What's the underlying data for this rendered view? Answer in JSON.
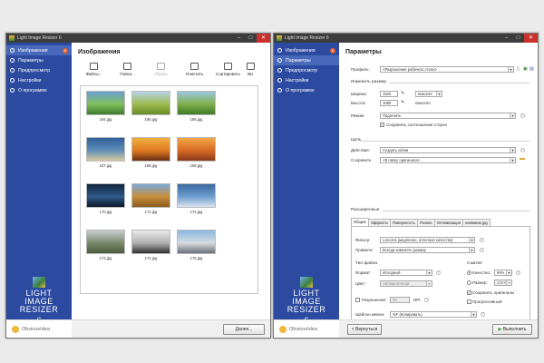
{
  "window_title": "Light Image Resizer 6",
  "nav": {
    "items": [
      "Изображения",
      "Параметры",
      "Предпросмотр",
      "Настройки",
      "О программе"
    ],
    "badge": "6"
  },
  "logo": {
    "line1": "LIGHT",
    "line2": "IMAGE",
    "line3": "RESIZER",
    "version": "6"
  },
  "brand": "ObviousIdea",
  "images_page": {
    "title": "Изображения",
    "toolbar": [
      "Файлы...",
      "Папка...",
      "Убрать",
      "Очистить",
      "Сортировать",
      "Ви"
    ],
    "thumbnails": [
      {
        "name": "164.jpg",
        "colors": [
          "#6aa0d6",
          "#7fbf5a",
          "#3d7a2e"
        ]
      },
      {
        "name": "165.jpg",
        "colors": [
          "#b7d3e8",
          "#9dbb4e",
          "#6a8a26"
        ]
      },
      {
        "name": "166.jpg",
        "colors": [
          "#9cc7e0",
          "#7fb04a",
          "#3f7a26"
        ]
      },
      {
        "name": "167.jpg",
        "colors": [
          "#2f5f9a",
          "#5f8fb8",
          "#d8c9a0"
        ]
      },
      {
        "name": "168.jpg",
        "colors": [
          "#f0b040",
          "#e07a20",
          "#6a2e10"
        ]
      },
      {
        "name": "169.jpg",
        "colors": [
          "#f2a848",
          "#d86a24",
          "#8a3a1a"
        ]
      },
      {
        "name": "170.jpg",
        "colors": [
          "#10243c",
          "#2f5a8a",
          "#0c1a2a"
        ]
      },
      {
        "name": "171.jpg",
        "colors": [
          "#7aa8d8",
          "#c88e3a",
          "#8a5a20"
        ]
      },
      {
        "name": "172.jpg",
        "colors": [
          "#3a6aa0",
          "#6f9fd0",
          "#d8e4ee"
        ]
      },
      {
        "name": "173.jpg",
        "colors": [
          "#c8ccd0",
          "#7a8a6a",
          "#4a5a3a"
        ]
      },
      {
        "name": "174.jpg",
        "colors": [
          "#e8e8e8",
          "#b0b0b0",
          "#303030"
        ]
      },
      {
        "name": "175.jpg",
        "colors": [
          "#88b8e0",
          "#d8dce0",
          "#6a7078"
        ]
      }
    ],
    "next_button": "Далее..."
  },
  "params_page": {
    "title": "Параметры",
    "profile_label": "Профиль:",
    "profile_value": "<Разрешение рабочего стола>",
    "resize_section": "Изменить размер",
    "width_label": "Ширина:",
    "width_value": "1920",
    "width_unit": "пикселя",
    "height_label": "Высота:",
    "height_value": "1080",
    "height_unit": "пикселя",
    "mode_label": "Режим:",
    "mode_value": "Подогнать",
    "keep_ratio": "Сохранить соотношение сторон",
    "target_section": "Цель",
    "action_label": "Действие:",
    "action_value": "Создать копии",
    "save_label": "Сохранить:",
    "save_value": "<В папку оригинала>",
    "advanced_section": "Расширенные",
    "tabs": [
      "Общие",
      "Эффекты",
      "Поверхность",
      "Разное",
      "Оптимизация",
      "название.jpg"
    ],
    "filter_label": "Фильтр:",
    "filter_value": "Lanczos (медленно, отличное качество)",
    "rule_label": "Правило:",
    "rule_value": "Всегда изменять размер",
    "filetype_section": "Тип файла",
    "format_label": "Формат:",
    "format_value": "Исходный",
    "color_label": "Цвет:",
    "color_value": "Автоматически",
    "compress_section": "Сжатие",
    "quality_label": "Качество:",
    "quality_value": "90%",
    "size_label": "Размер:",
    "size_value": "100 КБ",
    "keep_original": "Сохранить оригиналы",
    "progressive": "Прогрессивный",
    "resolution_label": "Разрешение:",
    "resolution_value": "96",
    "resolution_unit": "DPI",
    "naming_label": "Шаблон имени:",
    "naming_value": "%F (Копировать)",
    "back_button": "< Вернуться",
    "run_button": "Выполнить"
  }
}
